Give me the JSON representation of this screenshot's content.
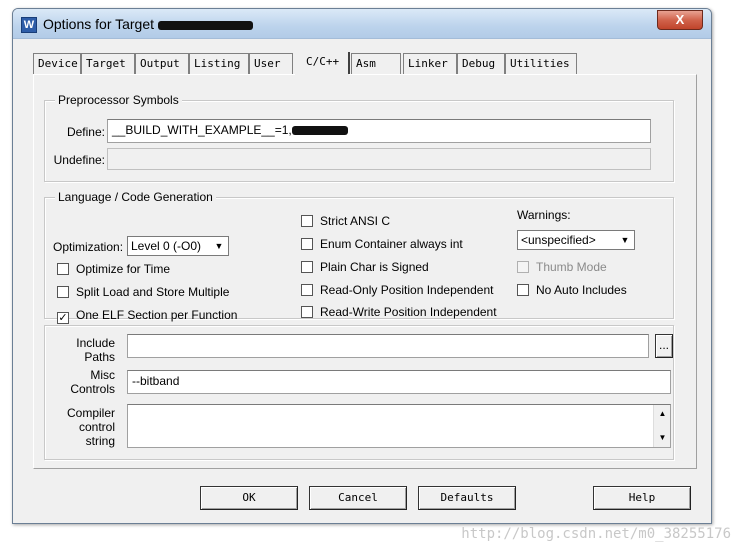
{
  "window": {
    "title": "Options for Target",
    "close_label": "X",
    "icon_label": "W"
  },
  "tabs": [
    {
      "label": "Device"
    },
    {
      "label": "Target"
    },
    {
      "label": "Output"
    },
    {
      "label": "Listing"
    },
    {
      "label": "User"
    },
    {
      "label": "C/C++"
    },
    {
      "label": "Asm"
    },
    {
      "label": "Linker"
    },
    {
      "label": "Debug"
    },
    {
      "label": "Utilities"
    }
  ],
  "preprocessor": {
    "title": "Preprocessor Symbols",
    "define_label": "Define:",
    "define_value": "__BUILD_WITH_EXAMPLE__=1,",
    "undefine_label": "Undefine:",
    "undefine_value": ""
  },
  "language": {
    "title": "Language / Code Generation",
    "optimization_label": "Optimization:",
    "optimization_value": "Level 0 (-O0)",
    "optimize_for_time": "Optimize for Time",
    "split_load_store": "Split Load and Store Multiple",
    "one_elf_section": "One ELF Section per Function",
    "strict_ansi": "Strict ANSI C",
    "enum_container": "Enum Container always int",
    "plain_char": "Plain Char is Signed",
    "ro_position": "Read-Only Position Independent",
    "rw_position": "Read-Write Position Independent",
    "warnings_label": "Warnings:",
    "warnings_value": "<unspecified>",
    "thumb_mode": "Thumb Mode",
    "no_auto_includes": "No Auto Includes"
  },
  "paths": {
    "include_label": "Include\nPaths",
    "include_value": "",
    "browse_label": "...",
    "misc_label": "Misc\nControls",
    "misc_value": "--bitband",
    "compiler_label": "Compiler\ncontrol\nstring",
    "compiler_value": ""
  },
  "buttons": {
    "ok": "OK",
    "cancel": "Cancel",
    "defaults": "Defaults",
    "help": "Help"
  },
  "watermark": "http://blog.csdn.net/m0_38255176"
}
